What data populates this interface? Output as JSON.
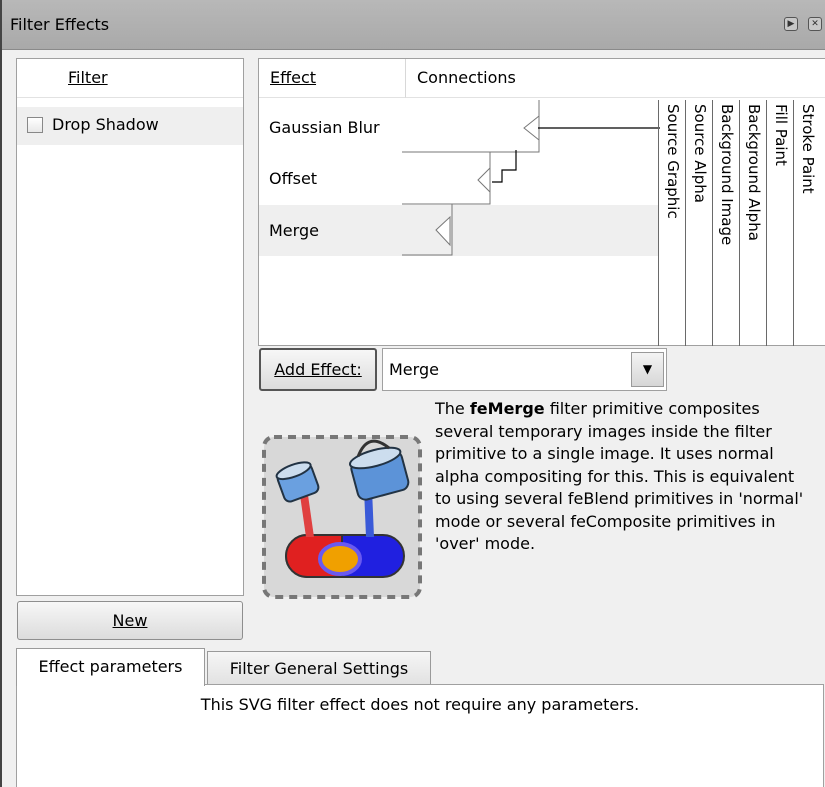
{
  "window": {
    "title": "Filter Effects"
  },
  "filter_list": {
    "header": "Filter",
    "items": [
      {
        "label": "Drop Shadow",
        "checked": false
      }
    ],
    "new_button": "New"
  },
  "effects": {
    "columns": {
      "effect": "Effect",
      "connections": "Connections"
    },
    "items": [
      "Gaussian Blur",
      "Offset",
      "Merge"
    ],
    "selected": "Merge",
    "sources": [
      "Source Graphic",
      "Source Alpha",
      "Background Image",
      "Background Alpha",
      "Fill Paint",
      "Stroke Paint"
    ]
  },
  "add_effect": {
    "button_label": "Add Effect:",
    "selected": "Merge"
  },
  "description": {
    "bold_term": "feMerge",
    "before": "The ",
    "after": " filter primitive composites several temporary images inside the filter primitive to a single image. It uses normal alpha compositing for this. This is equivalent to using several feBlend primitives in 'normal' mode or several feComposite primitives in 'over' mode."
  },
  "tabs": [
    {
      "label": "Effect parameters",
      "active": true
    },
    {
      "label": "Filter General Settings",
      "active": false
    }
  ],
  "parameters_message": "This SVG filter effect does not require any parameters.",
  "icons": {
    "title_play": "play-icon",
    "title_close": "close-icon",
    "dropdown": "chevron-down-icon",
    "merge_illustration": "merge-buckets-icon"
  }
}
